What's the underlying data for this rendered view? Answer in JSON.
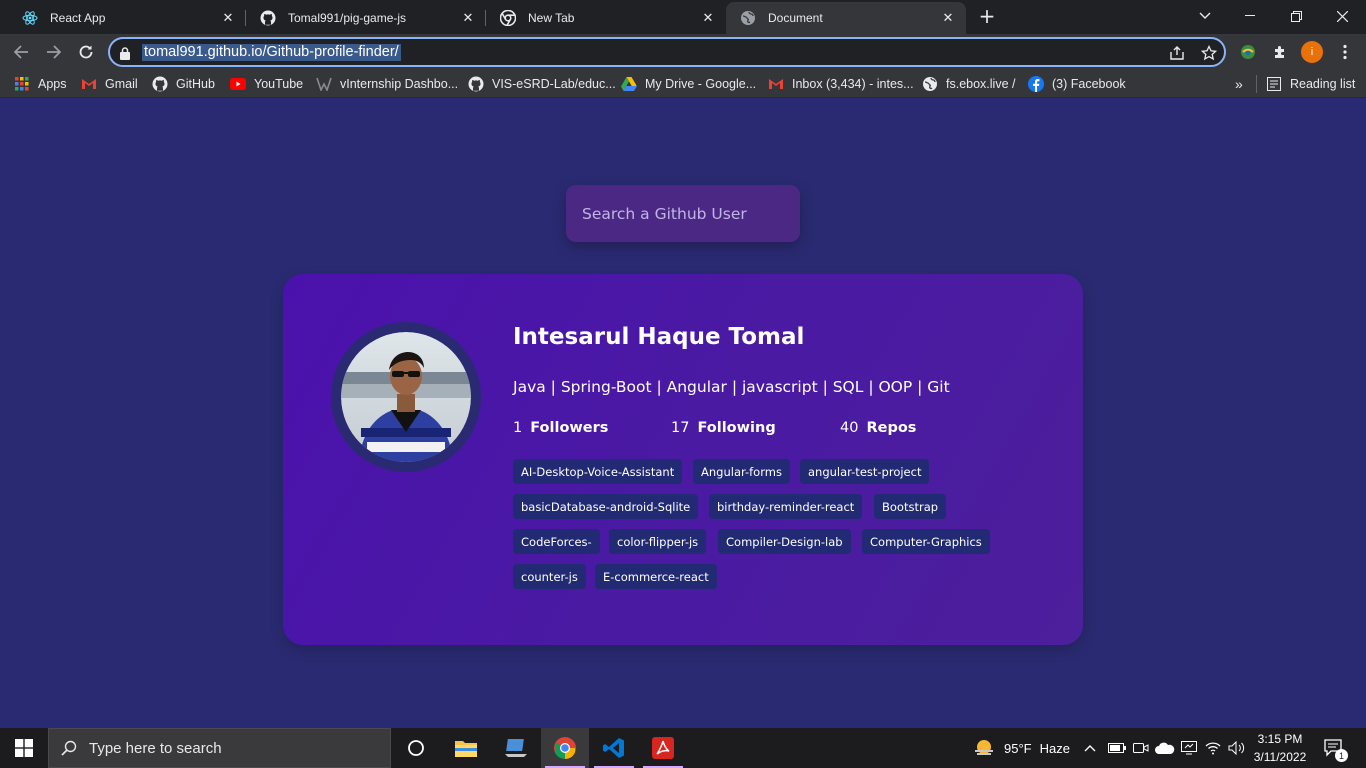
{
  "browser": {
    "tabs": [
      {
        "title": "React App",
        "icon": "react-icon"
      },
      {
        "title": "Tomal991/pig-game-js",
        "icon": "github-icon"
      },
      {
        "title": "New Tab",
        "icon": "chrome-icon"
      },
      {
        "title": "Document",
        "icon": "globe-icon",
        "active": true
      }
    ],
    "url": "tomal991.github.io/Github-profile-finder/",
    "profile_initial": "i",
    "bookmarks": [
      {
        "label": "Apps",
        "icon": "apps-grid-icon"
      },
      {
        "label": "Gmail",
        "icon": "gmail-icon"
      },
      {
        "label": "GitHub",
        "icon": "github-icon"
      },
      {
        "label": "YouTube",
        "icon": "youtube-icon"
      },
      {
        "label": "vInternship Dashbo...",
        "icon": "vinternship-icon"
      },
      {
        "label": "VIS-eSRD-Lab/educ...",
        "icon": "github-icon"
      },
      {
        "label": "My Drive - Google...",
        "icon": "google-drive-icon"
      },
      {
        "label": "Inbox (3,434) - intes...",
        "icon": "gmail-icon"
      },
      {
        "label": "fs.ebox.live /",
        "icon": "globe-icon"
      },
      {
        "label": "(3) Facebook",
        "icon": "facebook-icon"
      }
    ],
    "more_bookmarks": "»",
    "reading_list": "Reading list"
  },
  "page": {
    "search_placeholder": "Search a Github User",
    "profile": {
      "name": "Intesarul Haque Tomal",
      "bio": "Java | Spring-Boot | Angular | javascript | SQL | OOP | Git",
      "followers": {
        "count": "1",
        "label": "Followers"
      },
      "following": {
        "count": "17",
        "label": "Following"
      },
      "repos": {
        "count": "40",
        "label": "Repos"
      },
      "repo_list": [
        "AI-Desktop-Voice-Assistant",
        "Angular-forms",
        "angular-test-project",
        "basicDatabase-android-Sqlite",
        "birthday-reminder-react",
        "Bootstrap",
        "CodeForces-",
        "color-flipper-js",
        "Compiler-Design-lab",
        "Computer-Graphics",
        "counter-js",
        "E-commerce-react"
      ]
    }
  },
  "taskbar": {
    "search_placeholder": "Type here to search",
    "weather": {
      "temp": "95°F",
      "condition": "Haze"
    },
    "time": "3:15 PM",
    "date": "3/11/2022",
    "notification_count": "1"
  },
  "colors": {
    "page_bg": "#2a2a72",
    "card_bg": "#4b11ad",
    "repo_tag_bg": "#212a72",
    "search_bg": "#4c2885"
  }
}
